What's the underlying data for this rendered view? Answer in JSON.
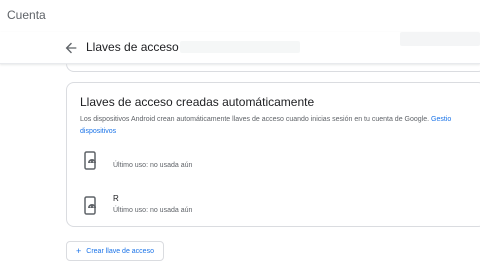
{
  "app": {
    "brand_mark": "",
    "brand": "Cuenta"
  },
  "header": {
    "title": "Llaves de acceso"
  },
  "section": {
    "title": "Llaves de acceso creadas automáticamente",
    "description": "Los dispositivos Android crean automáticamente llaves de acceso cuando inicias sesión en tu cuenta de Google.",
    "link": "Gestionar dispositivos",
    "link_line1": "Gestio",
    "link_line2": "dispositivos"
  },
  "devices": [
    {
      "name": "",
      "last_used": "Último uso: no usada aún",
      "icon": "android-phone-icon"
    },
    {
      "name": "R",
      "last_used": "Último uso: no usada aún",
      "icon": "android-phone-icon"
    }
  ],
  "actions": {
    "create_label": "Crear llave de acceso"
  },
  "colors": {
    "accent": "#1a73e8",
    "text": "#202124",
    "muted": "#5f6368",
    "border": "#dadce0"
  }
}
